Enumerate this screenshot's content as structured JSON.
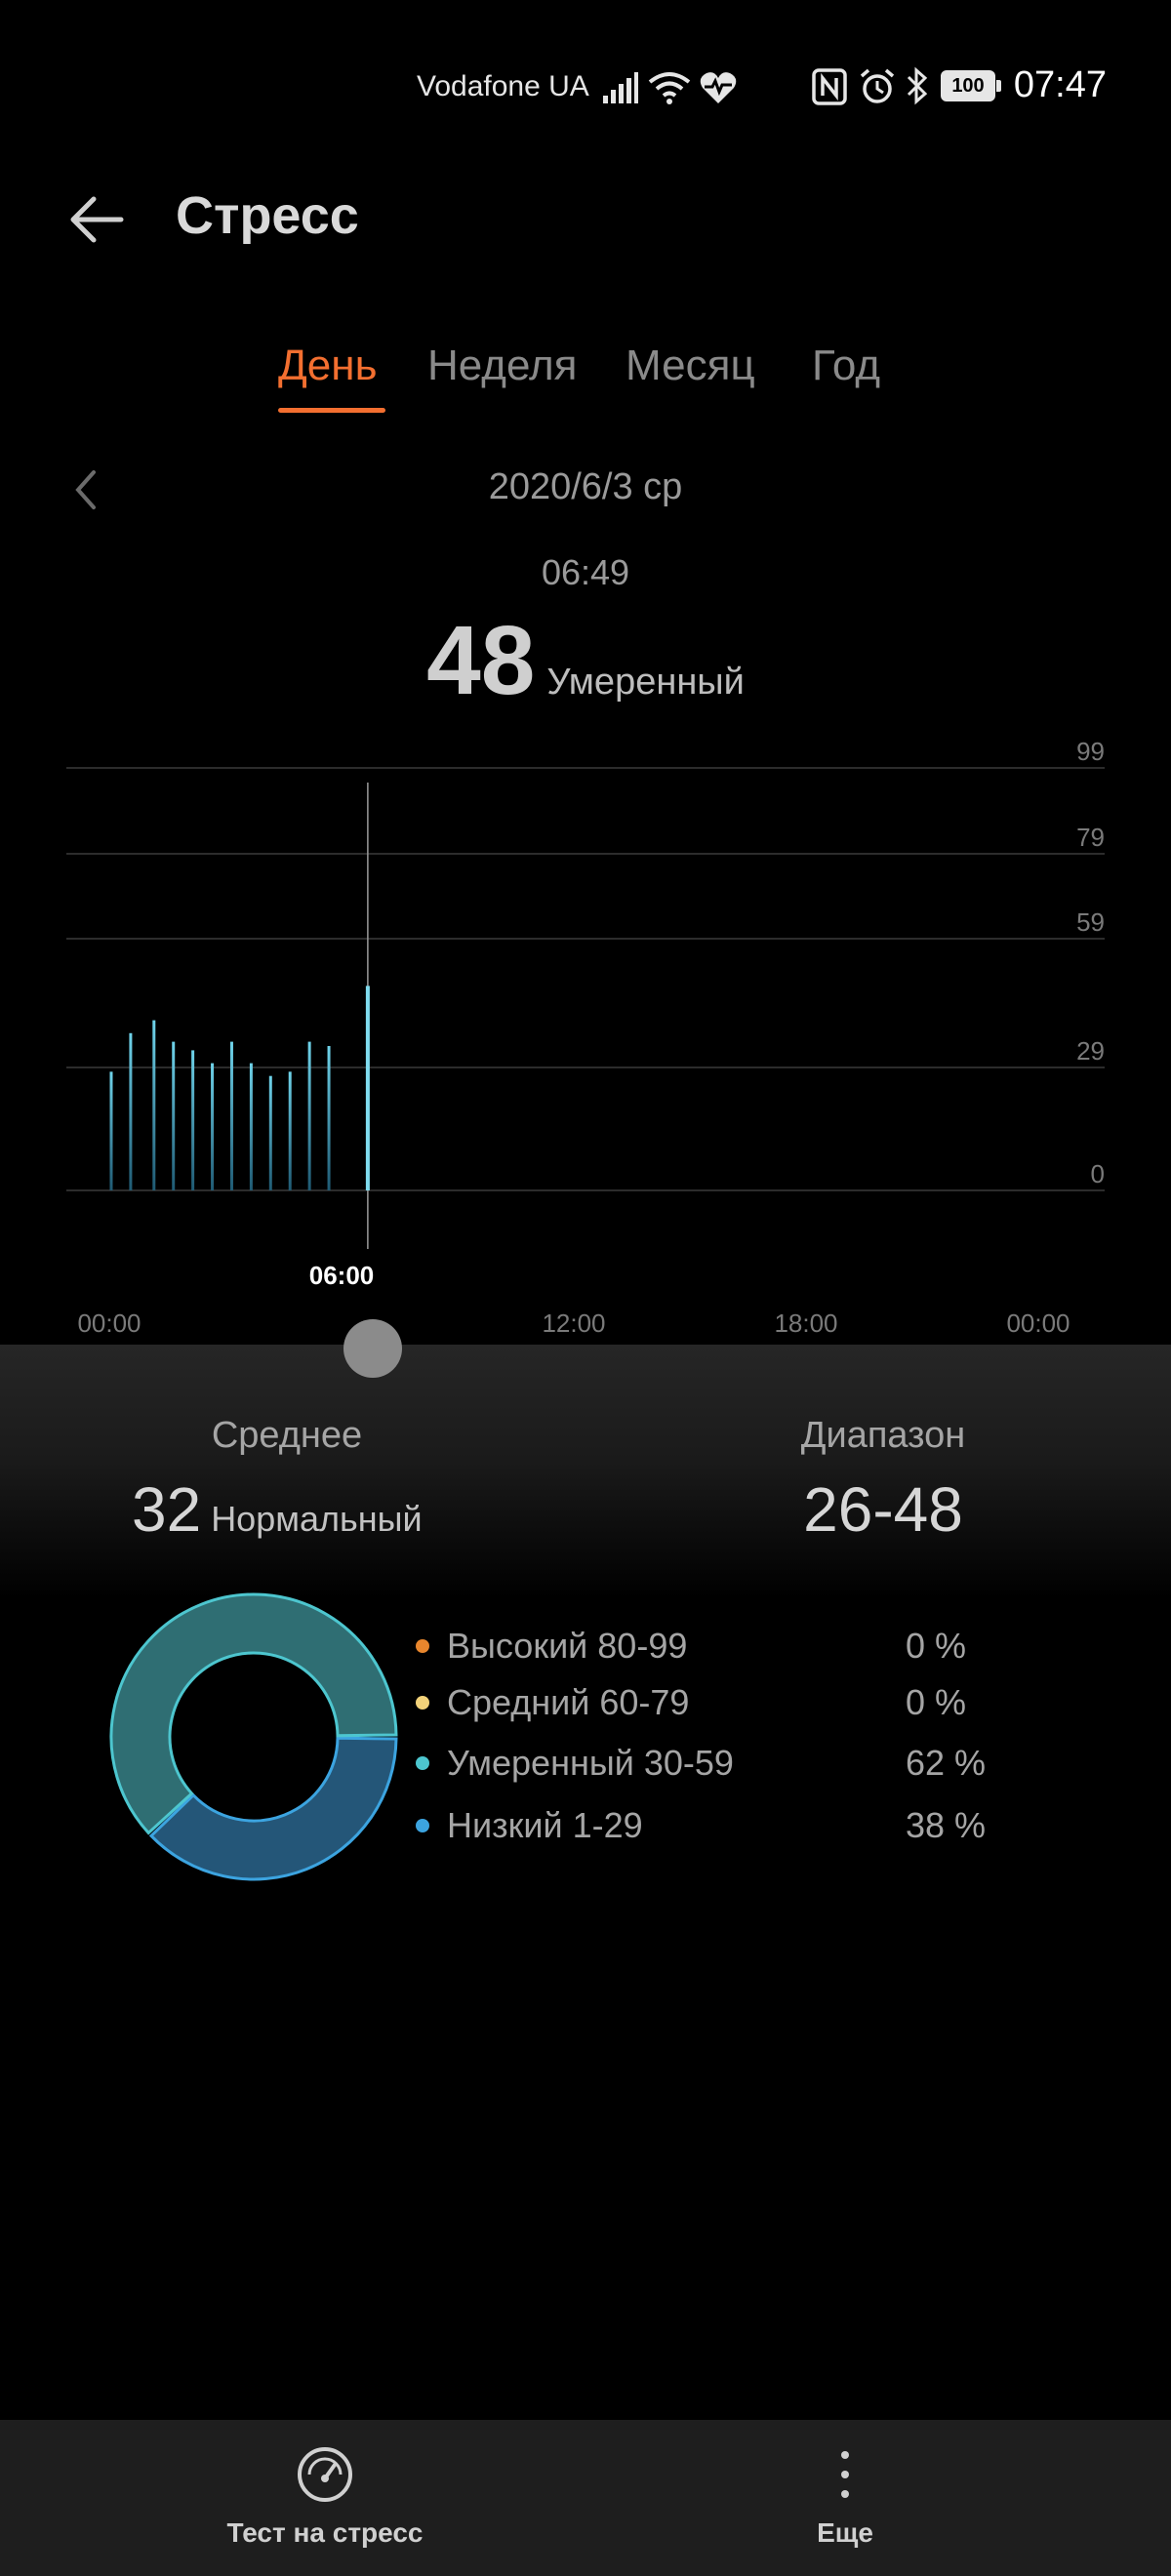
{
  "status_bar": {
    "carrier": "Vodafone UA",
    "battery": "100",
    "time": "07:47",
    "icons": [
      "signal-icon",
      "wifi-icon",
      "heart-monitor-icon",
      "nfc-icon",
      "alarm-icon",
      "bluetooth-icon",
      "battery-icon"
    ]
  },
  "header": {
    "title": "Стресс",
    "back_icon": "arrow-left-icon"
  },
  "tabs": [
    {
      "label": "День",
      "active": true
    },
    {
      "label": "Неделя",
      "active": false
    },
    {
      "label": "Месяц",
      "active": false
    },
    {
      "label": "Год",
      "active": false
    }
  ],
  "date": "2020/6/3  ср",
  "selection": {
    "time": "06:49",
    "value": "48",
    "level": "Умеренный",
    "cursor_label": "06:00"
  },
  "chart_data": {
    "type": "bar",
    "y_ticks": [
      99,
      79,
      59,
      29,
      0
    ],
    "ylim": [
      0,
      99
    ],
    "x_tick_labels": [
      "00:00",
      "06:00",
      "12:00",
      "18:00",
      "00:00"
    ],
    "x_range_hours": [
      0,
      24
    ],
    "accent_color": "#5ec4df",
    "points": [
      {
        "t": 0.1,
        "v": 28
      },
      {
        "t": 0.6,
        "v": 37
      },
      {
        "t": 1.2,
        "v": 40
      },
      {
        "t": 1.7,
        "v": 35
      },
      {
        "t": 2.2,
        "v": 33
      },
      {
        "t": 2.7,
        "v": 30
      },
      {
        "t": 3.2,
        "v": 35
      },
      {
        "t": 3.7,
        "v": 30
      },
      {
        "t": 4.2,
        "v": 27
      },
      {
        "t": 4.7,
        "v": 28
      },
      {
        "t": 5.2,
        "v": 35
      },
      {
        "t": 5.7,
        "v": 34
      },
      {
        "t": 6.7,
        "v": 48
      }
    ],
    "selected_t": 6.7
  },
  "summary": {
    "avg_label": "Среднее",
    "avg_value": "32",
    "avg_level": "Нормальный",
    "range_label": "Диапазон",
    "range_value": "26-48"
  },
  "distribution": [
    {
      "name": "Высокий 80-99",
      "pct": "0 %",
      "value": 0,
      "color": "#e8862d"
    },
    {
      "name": "Средний 60-79",
      "pct": "0 %",
      "value": 0,
      "color": "#f2d27a"
    },
    {
      "name": "Умеренный 30-59",
      "pct": "62 %",
      "value": 62,
      "color": "#4dc6cf"
    },
    {
      "name": "Низкий 1-29",
      "pct": "38 %",
      "value": 38,
      "color": "#3ca4e0"
    }
  ],
  "bottom_bar": {
    "test_label": "Тест на стресс",
    "more_label": "Еще"
  }
}
